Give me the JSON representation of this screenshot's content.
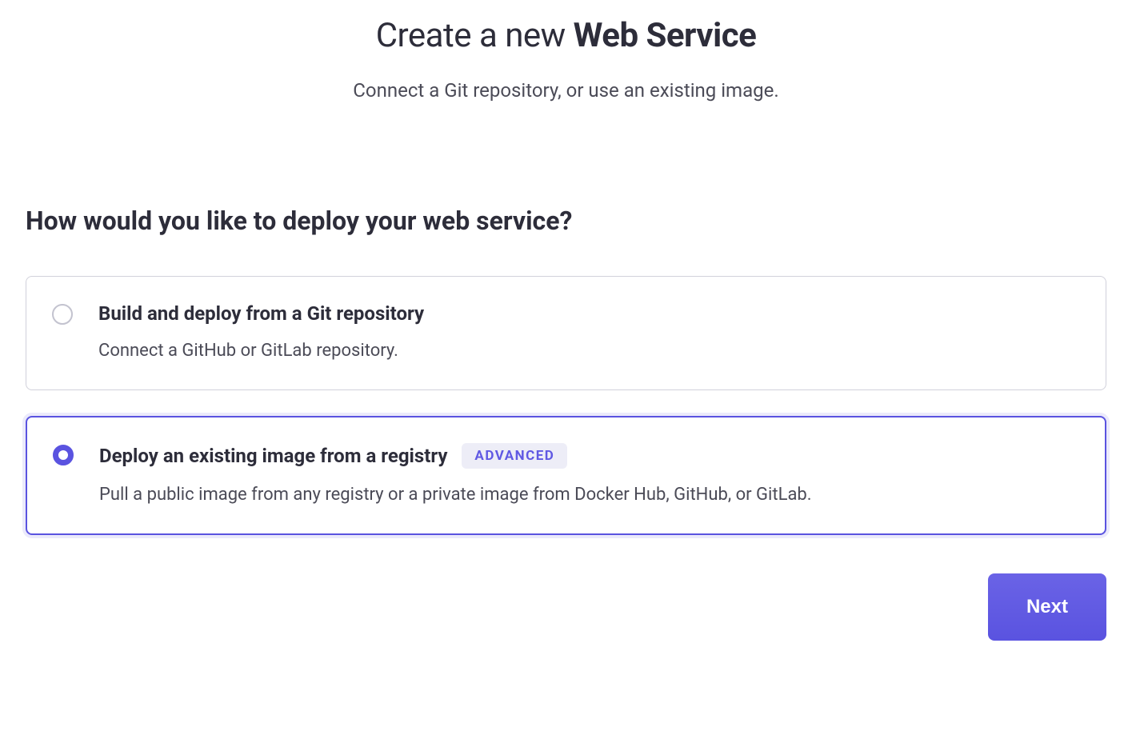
{
  "header": {
    "title_prefix": "Create a new ",
    "title_bold": "Web Service",
    "subtitle": "Connect a Git repository, or use an existing image."
  },
  "section_heading": "How would you like to deploy your web service?",
  "options": [
    {
      "title": "Build and deploy from a Git repository",
      "description": "Connect a GitHub or GitLab repository.",
      "badge": null,
      "selected": false
    },
    {
      "title": "Deploy an existing image from a registry",
      "description": "Pull a public image from any registry or a private image from Docker Hub, GitHub, or GitLab.",
      "badge": "ADVANCED",
      "selected": true
    }
  ],
  "footer": {
    "next_label": "Next"
  }
}
